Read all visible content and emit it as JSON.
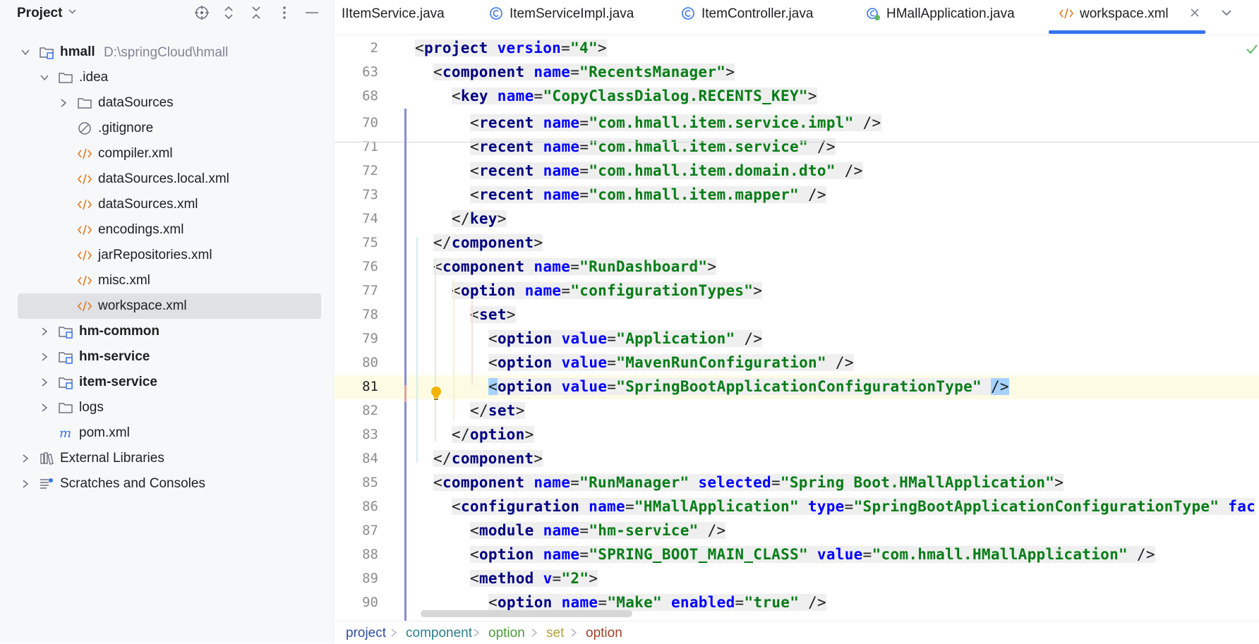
{
  "project_panel": {
    "title": "Project",
    "tree": [
      {
        "label": "hmall",
        "path": "D:\\springCloud\\hmall",
        "bold": true
      },
      {
        "label": ".idea"
      },
      {
        "label": "dataSources"
      },
      {
        "label": ".gitignore"
      },
      {
        "label": "compiler.xml"
      },
      {
        "label": "dataSources.local.xml"
      },
      {
        "label": "dataSources.xml"
      },
      {
        "label": "encodings.xml"
      },
      {
        "label": "jarRepositories.xml"
      },
      {
        "label": "misc.xml"
      },
      {
        "label": "workspace.xml",
        "selected": true
      },
      {
        "label": "hm-common",
        "bold": true
      },
      {
        "label": "hm-service",
        "bold": true
      },
      {
        "label": "item-service",
        "bold": true
      },
      {
        "label": "logs"
      },
      {
        "label": "pom.xml"
      },
      {
        "label": "External Libraries"
      },
      {
        "label": "Scratches and Consoles"
      }
    ]
  },
  "tabs": [
    {
      "label": "IItemService.java",
      "icon": "interface-icon"
    },
    {
      "label": "ItemServiceImpl.java",
      "icon": "class-icon"
    },
    {
      "label": "ItemController.java",
      "icon": "class-icon"
    },
    {
      "label": "HMallApplication.java",
      "icon": "spring-class-icon"
    },
    {
      "label": "workspace.xml",
      "icon": "xml-icon",
      "active": true
    }
  ],
  "editor": {
    "lines": [
      {
        "num": "2",
        "indent": 0,
        "tokens": [
          [
            "pn",
            "<"
          ],
          [
            "tg",
            "project"
          ],
          [
            "pn",
            " "
          ],
          [
            "an",
            "version"
          ],
          [
            "pn",
            "="
          ],
          [
            "av",
            "\"4\""
          ],
          [
            "pn",
            ">"
          ]
        ]
      },
      {
        "num": "63",
        "indent": 1,
        "tokens": [
          [
            "pn",
            "<"
          ],
          [
            "tg",
            "component"
          ],
          [
            "pn",
            " "
          ],
          [
            "an",
            "name"
          ],
          [
            "pn",
            "="
          ],
          [
            "av",
            "\"RecentsManager\""
          ],
          [
            "pn",
            ">"
          ]
        ]
      },
      {
        "num": "68",
        "indent": 2,
        "tokens": [
          [
            "pn",
            "<"
          ],
          [
            "tg",
            "key"
          ],
          [
            "pn",
            " "
          ],
          [
            "an",
            "name"
          ],
          [
            "pn",
            "="
          ],
          [
            "av",
            "\"CopyClassDialog.RECENTS_KEY\""
          ],
          [
            "pn",
            ">"
          ]
        ]
      },
      {
        "num": "70",
        "indent": 3,
        "tokens": [
          [
            "pn",
            "<"
          ],
          [
            "tg",
            "recent"
          ],
          [
            "pn",
            " "
          ],
          [
            "an",
            "name"
          ],
          [
            "pn",
            "="
          ],
          [
            "av",
            "\"com.hmall.item.service.impl\""
          ],
          [
            "pn",
            " />"
          ]
        ]
      },
      {
        "num": "71",
        "indent": 3,
        "tokens": [
          [
            "pn",
            "<"
          ],
          [
            "tg",
            "recent"
          ],
          [
            "pn",
            " "
          ],
          [
            "an",
            "name"
          ],
          [
            "pn",
            "="
          ],
          [
            "av",
            "\"com.hmall.item.service\""
          ],
          [
            "pn",
            " />"
          ]
        ]
      },
      {
        "num": "72",
        "indent": 3,
        "tokens": [
          [
            "pn",
            "<"
          ],
          [
            "tg",
            "recent"
          ],
          [
            "pn",
            " "
          ],
          [
            "an",
            "name"
          ],
          [
            "pn",
            "="
          ],
          [
            "av",
            "\"com.hmall.item.domain.dto\""
          ],
          [
            "pn",
            " />"
          ]
        ]
      },
      {
        "num": "73",
        "indent": 3,
        "tokens": [
          [
            "pn",
            "<"
          ],
          [
            "tg",
            "recent"
          ],
          [
            "pn",
            " "
          ],
          [
            "an",
            "name"
          ],
          [
            "pn",
            "="
          ],
          [
            "av",
            "\"com.hmall.item.mapper\""
          ],
          [
            "pn",
            " />"
          ]
        ]
      },
      {
        "num": "74",
        "indent": 2,
        "tokens": [
          [
            "pn",
            "</"
          ],
          [
            "tg",
            "key"
          ],
          [
            "pn",
            ">"
          ]
        ]
      },
      {
        "num": "75",
        "indent": 1,
        "tokens": [
          [
            "pn",
            "</"
          ],
          [
            "tg",
            "component"
          ],
          [
            "pn",
            ">"
          ]
        ]
      },
      {
        "num": "76",
        "indent": 1,
        "tokens": [
          [
            "pn",
            "<"
          ],
          [
            "tg",
            "component"
          ],
          [
            "pn",
            " "
          ],
          [
            "an",
            "name"
          ],
          [
            "pn",
            "="
          ],
          [
            "av",
            "\"RunDashboard\""
          ],
          [
            "pn",
            ">"
          ]
        ]
      },
      {
        "num": "77",
        "indent": 2,
        "tokens": [
          [
            "pn",
            "<"
          ],
          [
            "tg",
            "option"
          ],
          [
            "pn",
            " "
          ],
          [
            "an",
            "name"
          ],
          [
            "pn",
            "="
          ],
          [
            "av",
            "\"configurationTypes\""
          ],
          [
            "pn",
            ">"
          ]
        ]
      },
      {
        "num": "78",
        "indent": 3,
        "tokens": [
          [
            "pn",
            "<"
          ],
          [
            "tg",
            "set"
          ],
          [
            "pn",
            ">"
          ]
        ]
      },
      {
        "num": "79",
        "indent": 4,
        "tokens": [
          [
            "pn",
            "<"
          ],
          [
            "tg",
            "option"
          ],
          [
            "pn",
            " "
          ],
          [
            "an",
            "value"
          ],
          [
            "pn",
            "="
          ],
          [
            "av",
            "\"Application\""
          ],
          [
            "pn",
            " />"
          ]
        ]
      },
      {
        "num": "80",
        "indent": 4,
        "tokens": [
          [
            "pn",
            "<"
          ],
          [
            "tg",
            "option"
          ],
          [
            "pn",
            " "
          ],
          [
            "an",
            "value"
          ],
          [
            "pn",
            "="
          ],
          [
            "av",
            "\"MavenRunConfiguration\""
          ],
          [
            "pn",
            " />"
          ]
        ]
      },
      {
        "num": "81",
        "indent": 4,
        "current": true,
        "tokens": [
          [
            "hl",
            "<"
          ],
          [
            "tg",
            "option"
          ],
          [
            "pn",
            " "
          ],
          [
            "an",
            "value"
          ],
          [
            "pn",
            "="
          ],
          [
            "av",
            "\"SpringBootApplicationConfigurationType\""
          ],
          [
            "pn",
            " "
          ],
          [
            "hl",
            "/>"
          ]
        ]
      },
      {
        "num": "82",
        "indent": 3,
        "tokens": [
          [
            "pn",
            "</"
          ],
          [
            "tg",
            "set"
          ],
          [
            "pn",
            ">"
          ]
        ]
      },
      {
        "num": "83",
        "indent": 2,
        "tokens": [
          [
            "pn",
            "</"
          ],
          [
            "tg",
            "option"
          ],
          [
            "pn",
            ">"
          ]
        ]
      },
      {
        "num": "84",
        "indent": 1,
        "tokens": [
          [
            "pn",
            "</"
          ],
          [
            "tg",
            "component"
          ],
          [
            "pn",
            ">"
          ]
        ]
      },
      {
        "num": "85",
        "indent": 1,
        "tokens": [
          [
            "pn",
            "<"
          ],
          [
            "tg",
            "component"
          ],
          [
            "pn",
            " "
          ],
          [
            "an",
            "name"
          ],
          [
            "pn",
            "="
          ],
          [
            "av",
            "\"RunManager\""
          ],
          [
            "pn",
            " "
          ],
          [
            "an",
            "selected"
          ],
          [
            "pn",
            "="
          ],
          [
            "av",
            "\"Spring Boot.HMallApplication\""
          ],
          [
            "pn",
            ">"
          ]
        ]
      },
      {
        "num": "86",
        "indent": 2,
        "tokens": [
          [
            "pn",
            "<"
          ],
          [
            "tg",
            "configuration"
          ],
          [
            "pn",
            " "
          ],
          [
            "an",
            "name"
          ],
          [
            "pn",
            "="
          ],
          [
            "av",
            "\"HMallApplication\""
          ],
          [
            "pn",
            " "
          ],
          [
            "an",
            "type"
          ],
          [
            "pn",
            "="
          ],
          [
            "av",
            "\"SpringBootApplicationConfigurationType\""
          ],
          [
            "pn",
            " "
          ],
          [
            "an",
            "fac"
          ]
        ]
      },
      {
        "num": "87",
        "indent": 3,
        "tokens": [
          [
            "pn",
            "<"
          ],
          [
            "tg",
            "module"
          ],
          [
            "pn",
            " "
          ],
          [
            "an",
            "name"
          ],
          [
            "pn",
            "="
          ],
          [
            "av",
            "\"hm-service\""
          ],
          [
            "pn",
            " />"
          ]
        ]
      },
      {
        "num": "88",
        "indent": 3,
        "tokens": [
          [
            "pn",
            "<"
          ],
          [
            "tg",
            "option"
          ],
          [
            "pn",
            " "
          ],
          [
            "an",
            "name"
          ],
          [
            "pn",
            "="
          ],
          [
            "av",
            "\"SPRING_BOOT_MAIN_CLASS\""
          ],
          [
            "pn",
            " "
          ],
          [
            "an",
            "value"
          ],
          [
            "pn",
            "="
          ],
          [
            "av",
            "\"com.hmall.HMallApplication\""
          ],
          [
            "pn",
            " />"
          ]
        ]
      },
      {
        "num": "89",
        "indent": 3,
        "tokens": [
          [
            "pn",
            "<"
          ],
          [
            "tg",
            "method"
          ],
          [
            "pn",
            " "
          ],
          [
            "an",
            "v"
          ],
          [
            "pn",
            "="
          ],
          [
            "av",
            "\"2\""
          ],
          [
            "pn",
            ">"
          ]
        ]
      },
      {
        "num": "90",
        "indent": 4,
        "tokens": [
          [
            "pn",
            "<"
          ],
          [
            "tg",
            "option"
          ],
          [
            "pn",
            " "
          ],
          [
            "an",
            "name"
          ],
          [
            "pn",
            "="
          ],
          [
            "av",
            "\"Make\""
          ],
          [
            "pn",
            " "
          ],
          [
            "an",
            "enabled"
          ],
          [
            "pn",
            "="
          ],
          [
            "av",
            "\"true\""
          ],
          [
            "pn",
            " />"
          ]
        ]
      }
    ]
  },
  "breadcrumb": [
    {
      "label": "project",
      "color": "#2f4fa2"
    },
    {
      "label": "component",
      "color": "#2c7f8a"
    },
    {
      "label": "option",
      "color": "#4c9a3a"
    },
    {
      "label": "set",
      "color": "#b5a13b"
    },
    {
      "label": "option",
      "color": "#a0402a"
    }
  ],
  "colors": {
    "accent": "#3574f0",
    "tag": "#000080",
    "attr_name": "#0000ff",
    "attr_value": "#067d17",
    "xml_icon": "#e07a1f",
    "class_icon": "#3574f0"
  }
}
